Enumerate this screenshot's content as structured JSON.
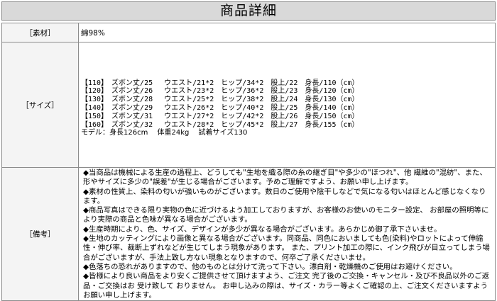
{
  "header": {
    "title": "商品詳細"
  },
  "rows": {
    "material": {
      "label": "［素材］",
      "value": "綿98%"
    },
    "size": {
      "label": "［サイズ］",
      "lines": [
        "【110】　ズボン丈/25　 ウエスト/21*2　ヒップ/34*2　股上/22　身長/110（cm）",
        "【120】　ズボン丈/26　 ウエスト/23*2　ヒップ/36*2　股上/23　身長/120（cm）",
        "【130】　ズボン丈/28　 ウエスト/25*2　ヒップ/38*2　股上/24　身長/130（cm）",
        "【140】　ズボン丈/29　 ウエスト/26*2　ヒップ/40*2　股上/25　身長/140（cm）",
        "【150】　ズボン丈/31　 ウエスト/27*2　ヒップ/42*2　股上/26　身長/150（cm）",
        "【160】　ズボン丈/32　 ウエスト/28*2　ヒップ/45*2　股上/27　身長/155（cm）"
      ],
      "model": "モデル：身長126cm　 体重24kg　 試着サイズ130"
    },
    "notes": {
      "label": "［備考］",
      "paragraphs": [
        "◆当商品は機械による生産の過程上、どうしても\"生地を織る際の糸の継ぎ目\"や多少の\"ほつれ\"、他 繊維の\"混紡\"、また、形やサイズに多少の\"誤差\"が生じる場合がございます。予めご理解ですよう、お願い申し上げます。",
        "◆素材の性質上、染料の匂いが強いものがございます。数日のご使用や陰干しなどで気になる匂いはほとんど感じなくなります。",
        "◆商品写真はできる限り実物の色に近づけるよう加工しておりますが、お客様のお使いのモニター設定、 お部屋の照明等により実際の商品と色味が異なる場合がございます。",
        "◆生産時期により、色、サイズ、デザインが多少が異なる場合がございます。あらかじめ御了承下さいませ。",
        "◆生地のカッティングにより画像と異なる場合がございます。同商品、同色においましても色(染料)やロットによって伸縮性・伸び率、裁断上ずれなどが生じてしまう現象があります。 また、プリント加工の際に、インク飛びが目立ってしまう場合がございますが、手法上致し方ない現象となりますので、何卒ご了承くださいませ。",
        "◆色落ちの恐れがありますので、他のものとは分けて洗って下さい。漂白剤・乾燥機のご使用はお避けください。",
        "◆皆様により良い商品をより安くご提供させて頂けますよう、ご注文 完了後のご交換・キャンセル・及び不良品以外のご返品・ご交換はお 受け致して おりません。 お申し込みの際は、サイズ・カラー等よくご確認の上、ご注文くださいますようお願い申し上げます。"
      ]
    }
  }
}
